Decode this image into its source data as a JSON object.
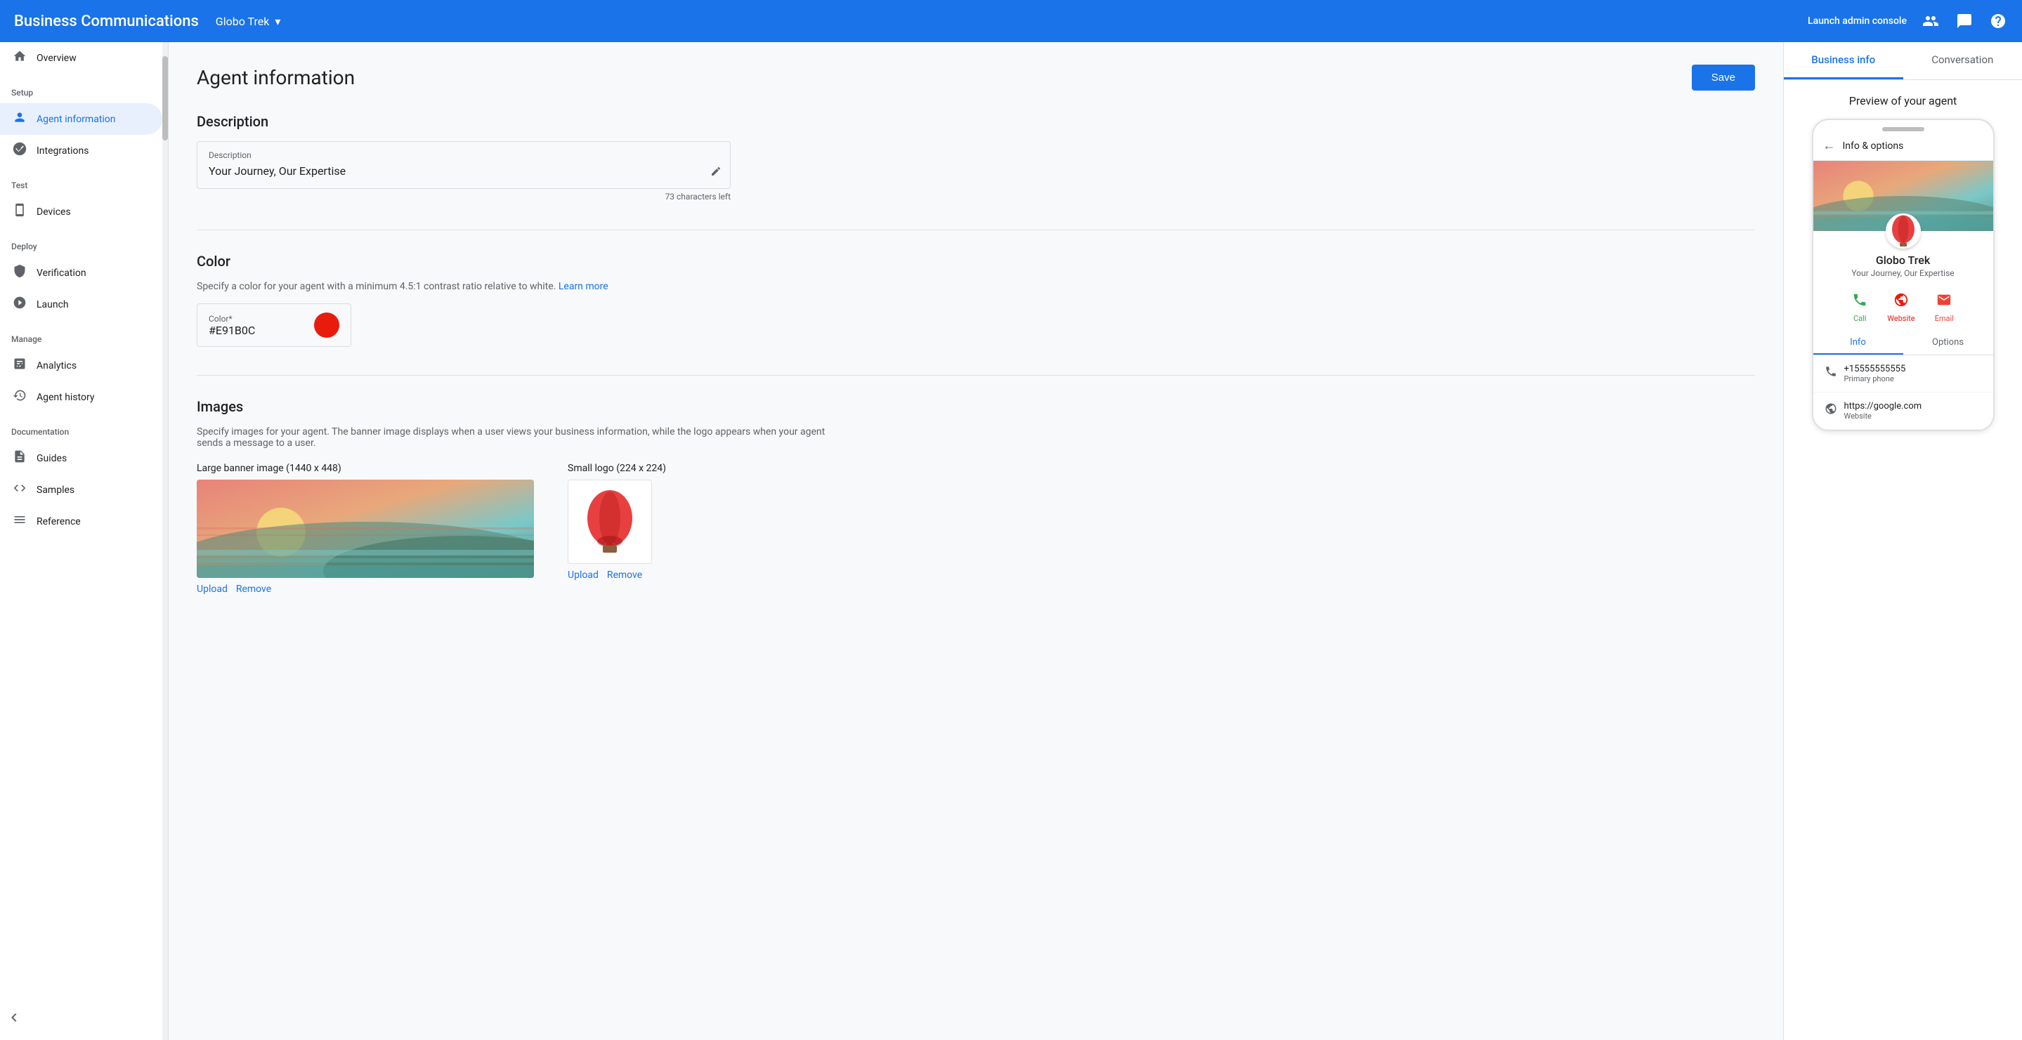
{
  "header": {
    "title": "Business Communications",
    "brand": "Globo Trek",
    "brand_arrow": "▾",
    "right_link": "Launch admin console",
    "icons": [
      "people-icon",
      "chat-icon",
      "help-icon"
    ]
  },
  "sidebar": {
    "sections": [
      {
        "label": "",
        "items": [
          {
            "id": "overview",
            "icon": "🏠",
            "label": "Overview",
            "active": false
          }
        ]
      },
      {
        "label": "Setup",
        "items": [
          {
            "id": "agent-information",
            "icon": "👤",
            "label": "Agent information",
            "active": true
          },
          {
            "id": "integrations",
            "icon": "⚙️",
            "label": "Integrations",
            "active": false
          }
        ]
      },
      {
        "label": "Test",
        "items": [
          {
            "id": "devices",
            "icon": "📱",
            "label": "Devices",
            "active": false
          }
        ]
      },
      {
        "label": "Deploy",
        "items": [
          {
            "id": "verification",
            "icon": "🛡️",
            "label": "Verification",
            "active": false
          },
          {
            "id": "launch",
            "icon": "🚀",
            "label": "Launch",
            "active": false
          }
        ]
      },
      {
        "label": "Manage",
        "items": [
          {
            "id": "analytics",
            "icon": "📈",
            "label": "Analytics",
            "active": false
          },
          {
            "id": "agent-history",
            "icon": "🕐",
            "label": "Agent history",
            "active": false
          }
        ]
      },
      {
        "label": "Documentation",
        "items": [
          {
            "id": "guides",
            "icon": "📄",
            "label": "Guides",
            "active": false
          },
          {
            "id": "samples",
            "icon": "🔷",
            "label": "Samples",
            "active": false
          },
          {
            "id": "reference",
            "icon": "≡",
            "label": "Reference",
            "active": false
          }
        ]
      }
    ],
    "chevron_up": "‹"
  },
  "main": {
    "page_title": "Agent information",
    "save_label": "Save",
    "description": {
      "section_title": "Description",
      "field_label": "Description",
      "field_value": "Your Journey, Our Expertise",
      "char_count": "73 characters left"
    },
    "color": {
      "section_title": "Color",
      "section_desc": "Specify a color for your agent with a minimum 4.5:1 contrast ratio relative to white.",
      "learn_more": "Learn more",
      "field_label": "Color*",
      "field_value": "#E91B0C",
      "swatch_color": "#E91B0C"
    },
    "images": {
      "section_title": "Images",
      "section_desc": "Specify images for your agent. The banner image displays when a user views your business information, while the logo appears when your agent sends a message to a user.",
      "banner_label": "Large banner image (1440 x 448)",
      "logo_label": "Small logo (224 x 224)",
      "upload_label": "Upload",
      "remove_label": "Remove"
    }
  },
  "right_panel": {
    "tabs": [
      {
        "id": "business-info",
        "label": "Business info",
        "active": true
      },
      {
        "id": "conversation",
        "label": "Conversation",
        "active": false
      }
    ],
    "preview_label": "Preview of your agent",
    "phone": {
      "topbar_label": "Info & options",
      "agent_name": "Globo Trek",
      "agent_desc": "Your Journey, Our Expertise",
      "actions": [
        {
          "id": "call",
          "label": "Call",
          "icon": "📞",
          "type": "call"
        },
        {
          "id": "website",
          "label": "Website",
          "icon": "🌐",
          "type": "website"
        },
        {
          "id": "email",
          "label": "Email",
          "icon": "✉️",
          "type": "email"
        }
      ],
      "info_tabs": [
        {
          "id": "info",
          "label": "Info",
          "active": true
        },
        {
          "id": "options",
          "label": "Options",
          "active": false
        }
      ],
      "info_rows": [
        {
          "icon": "📞",
          "value": "+15555555555",
          "label": "Primary phone"
        },
        {
          "icon": "🌐",
          "value": "https://google.com",
          "label": "Website"
        }
      ]
    }
  }
}
